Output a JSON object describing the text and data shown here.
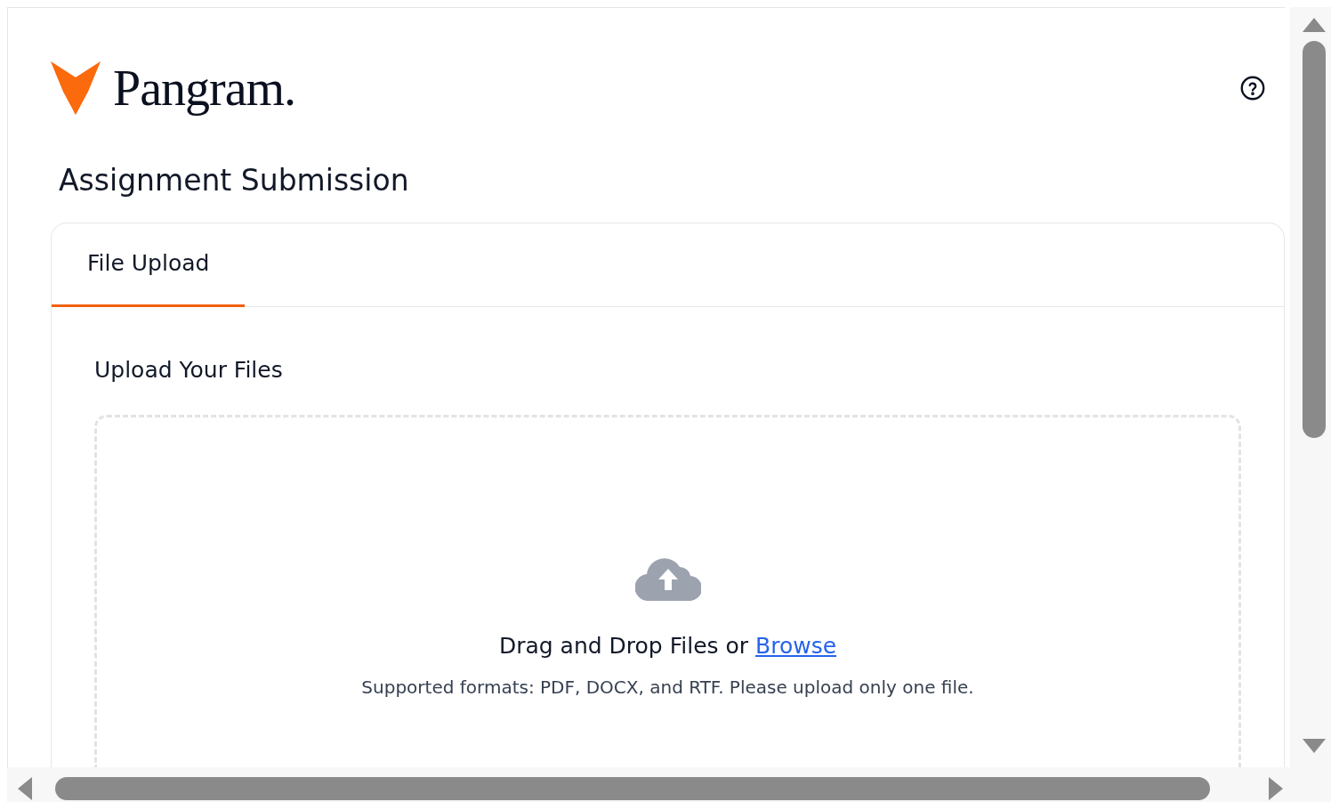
{
  "logo": {
    "text": "Pangram."
  },
  "page_title": "Assignment Submission",
  "tabs": [
    {
      "label": "File Upload",
      "selected": true
    }
  ],
  "upload": {
    "heading": "Upload Your Files",
    "prompt": "Drag and Drop Files or ",
    "link": "Browse",
    "hint": "Supported formats: PDF, DOCX, and RTF. Please upload only one file."
  }
}
